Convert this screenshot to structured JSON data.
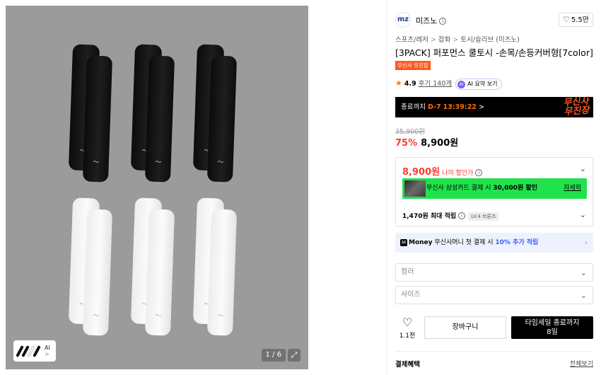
{
  "gallery": {
    "pager": "1 / 6",
    "thumb_label": "AI",
    "thumb_arrow": ">",
    "expand_icon": "⤢"
  },
  "product": {
    "brand_logo_text": "mz",
    "brand_name": "미즈노",
    "info_glyph": "i",
    "likes": "5.5만",
    "breadcrumb": [
      "스포츠/레저",
      "잡화",
      "토시/슬리브 (미즈노)"
    ],
    "breadcrumb_sep": ">",
    "title": "[3PACK] 퍼포먼스 쿨토시 -손목/손등커버형[7color]",
    "badge": "무신사 무진장",
    "rating": "4.9",
    "reviews": "후기 140개",
    "ai_summary": "AI 요약 보기",
    "ai_dot": "AI"
  },
  "timer": {
    "prefix": "종료까지",
    "days": "D-7",
    "time": "13:39:22",
    "arrow": ">",
    "brush_line1": "무신사",
    "brush_line2": "무진장"
  },
  "price": {
    "original": "35,900원",
    "discount": "75%",
    "sale": "8,900원"
  },
  "benefits": {
    "my_price": "8,900원",
    "my_price_label": "나의 할인가",
    "card_text_a": "무신사 삼성카드 결제 시",
    "card_text_b": "30,000원 할인",
    "card_more": "자세히",
    "points": "1,470원 최대 적립",
    "level": "LV.4 브론즈"
  },
  "money": {
    "logo_letter": "M",
    "brand": "Money",
    "text_a": "무신사머니 첫 결제 시",
    "text_b": "10% 추가 적립"
  },
  "options": {
    "color_placeholder": "컬러",
    "size_placeholder": "사이즈"
  },
  "actions": {
    "wish_count": "1.1천",
    "cart": "장바구니",
    "buy_line1": "타임세일 종료까지",
    "buy_line2": "8일"
  },
  "payment": {
    "title": "결제혜택",
    "view_all": "전체보기"
  },
  "colors": {
    "accent_red": "#ff3b30",
    "badge_orange": "#ff5a1f",
    "card_green": "#20e24a",
    "money_blue": "#3d5afe"
  }
}
